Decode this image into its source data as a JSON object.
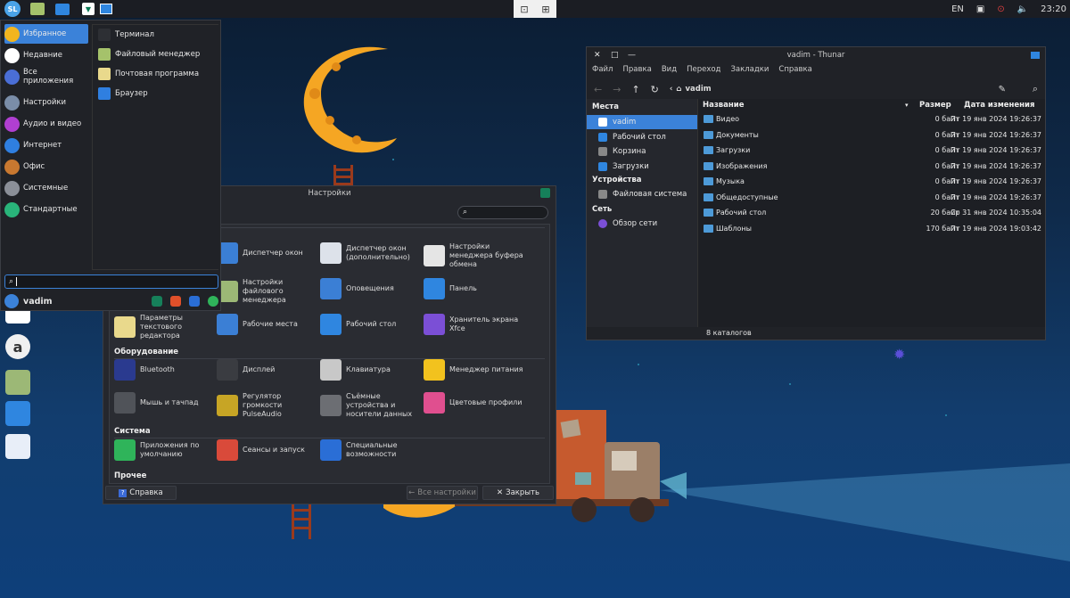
{
  "topbar": {
    "lang": "EN",
    "clock": "23:20",
    "icons": [
      "sl-logo-icon",
      "file-manager-icon",
      "window-icon",
      "terminal-icon",
      "workspace-switcher-icon",
      "brightness-icon",
      "network-icon",
      "volume-icon"
    ]
  },
  "menu": {
    "categories": [
      {
        "label": "Избранное",
        "icon": "star-icon",
        "color": "#f2b51e"
      },
      {
        "label": "Недавние",
        "icon": "clock-icon",
        "color": "#ffffff"
      },
      {
        "label": "Все приложения",
        "icon": "grid-icon",
        "color": "#4a6ed6"
      },
      {
        "label": "Настройки",
        "icon": "settings-icon",
        "color": "#7a8da8"
      },
      {
        "label": "Аудио и видео",
        "icon": "media-icon",
        "color": "#b03fd1"
      },
      {
        "label": "Интернет",
        "icon": "globe-icon",
        "color": "#2f7fe0"
      },
      {
        "label": "Офис",
        "icon": "briefcase-icon",
        "color": "#c87830"
      },
      {
        "label": "Системные",
        "icon": "gear-icon",
        "color": "#8b8f98"
      },
      {
        "label": "Стандартные",
        "icon": "tools-icon",
        "color": "#29b47a"
      }
    ],
    "apps": [
      {
        "label": "Терминал",
        "color": "#2d2f34"
      },
      {
        "label": "Файловый менеджер",
        "color": "#a5c26b"
      },
      {
        "label": "Почтовая программа",
        "color": "#e9d98c"
      },
      {
        "label": "Браузер",
        "color": "#2f7fe0"
      }
    ],
    "search_value": "",
    "username": "vadim"
  },
  "settings": {
    "title": "Настройки",
    "groups": [
      {
        "label": "Оборудование"
      },
      {
        "label": "Система"
      },
      {
        "label": "Прочее"
      }
    ],
    "personal_items": [
      {
        "label": "Диспетчер окон",
        "color": "#3b7fd5"
      },
      {
        "label": "Диспетчер окон (дополнительно)",
        "color": "#dde2ea"
      },
      {
        "label": "Настройки менеджера буфера обмена",
        "color": "#e5e5e5"
      },
      {
        "label": "Настройки файлового менеджера",
        "color": "#9cb876"
      },
      {
        "label": "Оповещения",
        "color": "#3b7fd5"
      },
      {
        "label": "Панель",
        "color": "#2f86e0"
      },
      {
        "label": "Параметры текстового редактора",
        "color": "#e9d98c"
      },
      {
        "label": "Рабочие места",
        "color": "#3b7fd5"
      },
      {
        "label": "Рабочий стол",
        "color": "#2f86e0"
      },
      {
        "label": "Хранитель экрана Xfce",
        "color": "#7b4fd6"
      }
    ],
    "hardware_items": [
      {
        "label": "Bluetooth",
        "color": "#2a3a8f"
      },
      {
        "label": "Дисплей",
        "color": "#3a3c41"
      },
      {
        "label": "Клавиатура",
        "color": "#c8c8c8"
      },
      {
        "label": "Менеджер питания",
        "color": "#f2c21e"
      },
      {
        "label": "Мышь и тачпад",
        "color": "#505359"
      },
      {
        "label": "Регулятор громкости PulseAudio",
        "color": "#c7a525"
      },
      {
        "label": "Съёмные устройства и носители данных",
        "color": "#6c6e73"
      },
      {
        "label": "Цветовые профили",
        "color": "#e04f8f"
      }
    ],
    "system_items": [
      {
        "label": "Приложения по умолчанию",
        "color": "#2fb45a"
      },
      {
        "label": "Сеансы и запуск",
        "color": "#d94a3a"
      },
      {
        "label": "Специальные возможности",
        "color": "#2a6ed6"
      }
    ],
    "help_label": "Справка",
    "all_label": "Все настройки",
    "close_label": "Закрыть"
  },
  "thunar": {
    "title": "vadim - Thunar",
    "menu": [
      "Файл",
      "Правка",
      "Вид",
      "Переход",
      "Закладки",
      "Справка"
    ],
    "location": "vadim",
    "sidebar": {
      "places_label": "Места",
      "places": [
        "vadim",
        "Рабочий стол",
        "Корзина",
        "Загрузки"
      ],
      "devices_label": "Устройства",
      "devices": [
        "Файловая система"
      ],
      "network_label": "Сеть",
      "network": [
        "Обзор сети"
      ]
    },
    "columns": {
      "name": "Название",
      "size": "Размер",
      "date": "Дата изменения"
    },
    "rows": [
      {
        "name": "Видео",
        "size": "0 байт",
        "date": "Пт 19 янв 2024 19:26:37"
      },
      {
        "name": "Документы",
        "size": "0 байт",
        "date": "Пт 19 янв 2024 19:26:37"
      },
      {
        "name": "Загрузки",
        "size": "0 байт",
        "date": "Пт 19 янв 2024 19:26:37"
      },
      {
        "name": "Изображения",
        "size": "0 байт",
        "date": "Пт 19 янв 2024 19:26:37"
      },
      {
        "name": "Музыка",
        "size": "0 байт",
        "date": "Пт 19 янв 2024 19:26:37"
      },
      {
        "name": "Общедоступные",
        "size": "0 байт",
        "date": "Пт 19 янв 2024 19:26:37"
      },
      {
        "name": "Рабочий стол",
        "size": "20 байт",
        "date": "Ср 31 янв 2024 10:35:04"
      },
      {
        "name": "Шаблоны",
        "size": "170 байт",
        "date": "Пт 19 янв 2024 19:03:42"
      }
    ],
    "status": "8 каталогов"
  },
  "colors": {
    "accent": "#3b82d9",
    "panel": "#1b1d23"
  }
}
